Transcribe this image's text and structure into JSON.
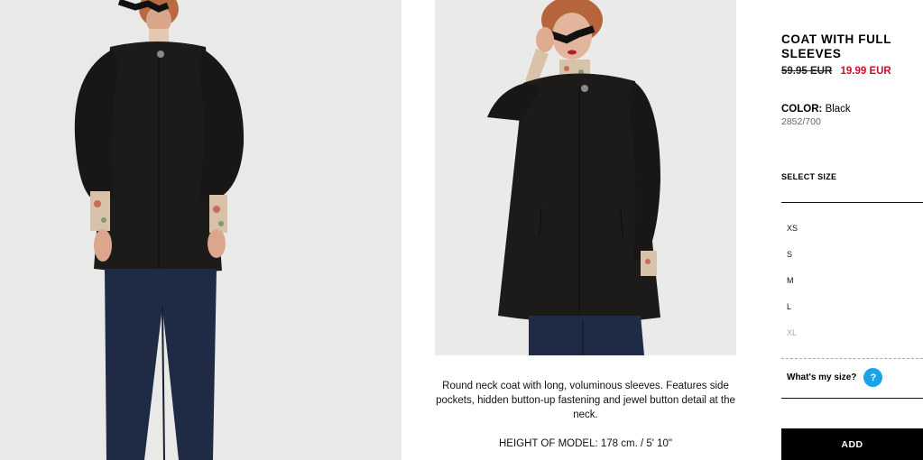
{
  "product": {
    "title": "COAT WITH FULL SLEEVES",
    "price_old": "59.95 EUR",
    "price_new": "19.99 EUR",
    "color_label": "COLOR:",
    "color_value": "Black",
    "reference": "2852/700"
  },
  "size_selector": {
    "label": "SELECT SIZE",
    "sizes": [
      {
        "label": "XS",
        "available": true
      },
      {
        "label": "S",
        "available": true
      },
      {
        "label": "M",
        "available": true
      },
      {
        "label": "L",
        "available": true
      },
      {
        "label": "XL",
        "available": false
      }
    ],
    "whats_my_size": "What's my size?",
    "help_glyph": "?"
  },
  "add_button": "ADD",
  "description": {
    "text": "Round neck coat with long, voluminous sleeves. Features side pockets, hidden button-up fastening and jewel button detail at the neck.",
    "model_height": "HEIGHT OF MODEL: 178 cm. / 5' 10\""
  },
  "colors": {
    "sale_red": "#c8102e",
    "help_blue": "#1aa3e8",
    "coat_black": "#1c1b19",
    "jeans_blue": "#1f2a44",
    "photo_bg": "#e9e9e7"
  },
  "images": [
    {
      "name": "product-photo-front",
      "subject": "model wearing black coat with blue jeans and sunglasses"
    },
    {
      "name": "product-photo-detail",
      "subject": "model holding sunglasses, black coat over floral shirt"
    }
  ]
}
